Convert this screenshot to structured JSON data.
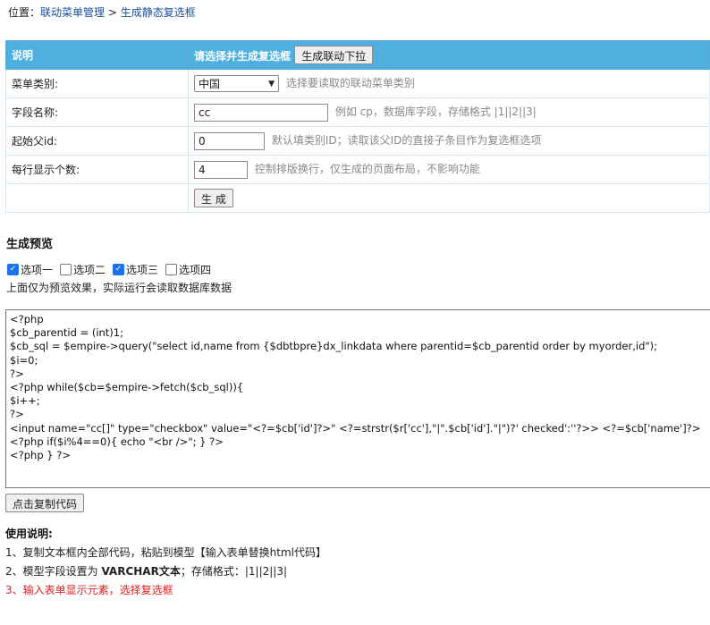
{
  "breadcrumb": {
    "prefix": "位置：",
    "link1": "联动菜单管理",
    "sep": " > ",
    "link2": "生成静态复选框"
  },
  "form": {
    "header": {
      "col1": "说明",
      "col2": "请选择并生成复选框",
      "button": "生成联动下拉"
    },
    "rows": {
      "category": {
        "label": "菜单类别:",
        "value": "中国",
        "hint": "选择要读取的联动菜单类别"
      },
      "field": {
        "label": "字段名称:",
        "value": "cc",
        "hint": "例如 cp，数据库字段，存储格式 |1||2||3|"
      },
      "parent": {
        "label": "起始父id:",
        "value": "0",
        "hint": "默认填类别ID；读取该父ID的直接子条目作为复选框选项"
      },
      "perline": {
        "label": "每行显示个数:",
        "value": "4",
        "hint": "控制排版换行，仅生成的页面布局，不影响功能"
      }
    },
    "submit": "生 成"
  },
  "preview": {
    "title": "生成预览",
    "options": [
      {
        "label": "选项一",
        "checked": true
      },
      {
        "label": "选项二",
        "checked": false
      },
      {
        "label": "选项三",
        "checked": true
      },
      {
        "label": "选项四",
        "checked": false
      }
    ],
    "note": "上面仅为预览效果，实际运行会读取数据库数据"
  },
  "code": "<?php\n$cb_parentid = (int)1;\n$cb_sql = $empire->query(\"select id,name from {$dbtbpre}dx_linkdata where parentid=$cb_parentid order by myorder,id\");\n$i=0;\n?>\n<?php while($cb=$empire->fetch($cb_sql)){\n$i++;\n?>\n<input name=\"cc[]\" type=\"checkbox\" value=\"<?=$cb['id']?>\" <?=strstr($r['cc'],\"|\".$cb['id'].\"|\")?' checked':''?>> <?=$cb['name']?>\n<?php if($i%4==0){ echo \"<br />\"; } ?>\n<?php } ?>",
  "copy_button": "点击复制代码",
  "usage": {
    "title": "使用说明:",
    "line1": "1、复制文本框内全部代码，粘贴到模型【输入表单替换html代码】",
    "line2_pre": "2、模型字段设置为 ",
    "line2_bold": "VARCHAR文本",
    "line2_post": "；存储格式：|1||2||3|",
    "line3": "3、输入表单显示元素，选择复选框"
  }
}
